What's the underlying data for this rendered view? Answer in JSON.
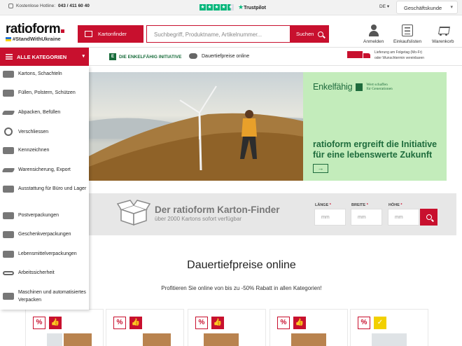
{
  "topbar": {
    "hotline_label": "Kostenlose Hotline:",
    "hotline_number": "043 / 411 60 40",
    "trustpilot": "Trustpilot",
    "language": "DE",
    "customer_type": "Geschäftskunde"
  },
  "header": {
    "logo": "ratioform",
    "logo_sub": "#StandWithUkraine",
    "kartonfinder_label": "Kartonfinder",
    "search_placeholder": "Suchbegriff, Produktname, Artikelnummer...",
    "search_button": "Suchen",
    "login_label": "Anmelden",
    "lists_label": "Einkaufslisten",
    "cart_label": "Warenkorb"
  },
  "nav": {
    "all_categories": "ALLE KATEGORIEN",
    "enkelfaehig_link": "DIE ENKELFÄHIG INITIATIVE",
    "dauertiefpreise_link": "Dauertiefpreise online",
    "delivery_line1": "Lieferung am Folgetag (Mo-Fr)",
    "delivery_line2": "oder Wunschtermin vereinbaren"
  },
  "sidebar": {
    "items": [
      {
        "label": "Kartons, Schachteln",
        "icon": "box-icon"
      },
      {
        "label": "Füllen, Polstern, Schützen",
        "icon": "padding-icon"
      },
      {
        "label": "Abpacken, Befüllen",
        "icon": "bag-icon"
      },
      {
        "label": "Verschliessen",
        "icon": "tape-icon"
      },
      {
        "label": "Kennzeichnen",
        "icon": "label-icon"
      },
      {
        "label": "Warensicherung, Export",
        "icon": "strap-icon"
      },
      {
        "label": "Ausstattung für Büro und Lager",
        "icon": "office-icon"
      },
      {
        "label": "Postverpackungen",
        "icon": "mail-icon"
      },
      {
        "label": "Geschenkverpackungen",
        "icon": "gift-icon"
      },
      {
        "label": "Lebensmittelverpackungen",
        "icon": "food-icon"
      },
      {
        "label": "Arbeitssicherheit",
        "icon": "glasses-icon"
      },
      {
        "label": "Maschinen und automatisiertes Verpacken",
        "icon": "machine-icon"
      }
    ]
  },
  "hero": {
    "brand": "Enkelfähig",
    "tagline_1": "Wert schaffen",
    "tagline_2": "für Generationen",
    "headline": "ratioform ergreift die Initiative für eine lebenswerte Zukunft",
    "arrow": "→"
  },
  "finder": {
    "title": "Der ratioform Karton-Finder",
    "subtitle": "über 2000 Kartons sofort verfügbar",
    "length_label": "LÄNGE",
    "width_label": "BREITE",
    "height_label": "HÖHE",
    "required_mark": "*",
    "unit_placeholder": "mm"
  },
  "content": {
    "title": "Dauertiefpreise online",
    "subtitle": "Profitieren Sie online von bis zu -50% Rabatt in allen Kategorien!",
    "badge_percent": "%",
    "badge_thumb": "👍",
    "badge_check": "✓"
  },
  "colors": {
    "brand_red": "#c8102e",
    "enkelfaehig_green": "#1e6b3c",
    "hero_green": "#c3ecbb",
    "trustpilot_green": "#00b67a"
  }
}
